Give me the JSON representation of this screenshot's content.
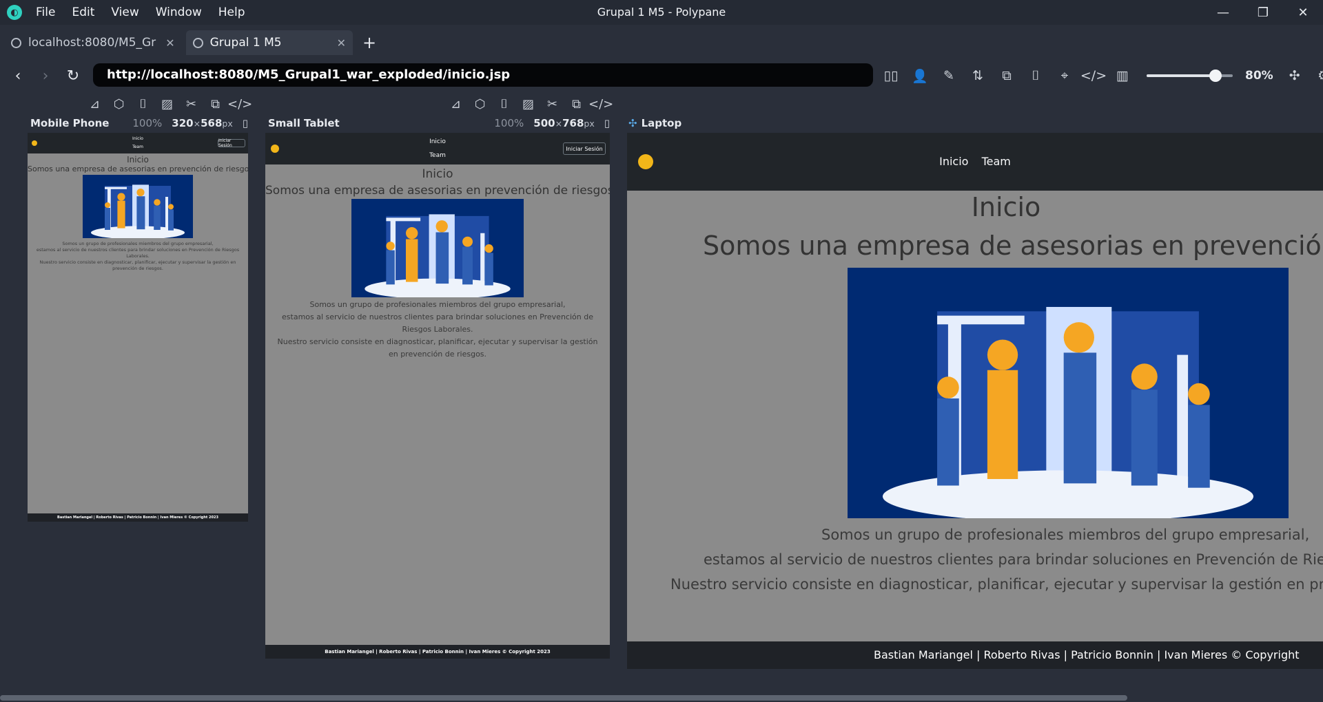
{
  "window": {
    "menu": [
      "File",
      "Edit",
      "View",
      "Window",
      "Help"
    ],
    "title": "Grupal 1 M5 - Polypane"
  },
  "tabs": [
    {
      "label": "localhost:8080/M5_Gr"
    },
    {
      "label": "Grupal 1 M5"
    }
  ],
  "address": {
    "url": "http://localhost:8080/M5_Grupal1_war_exploded/inicio.jsp",
    "zoom": "80%",
    "zoom_level": 0.8
  },
  "panes": {
    "mobile": {
      "name": "Mobile Phone",
      "pct": "100%",
      "w": "320",
      "h": "568",
      "unit": "px"
    },
    "tablet": {
      "name": "Small Tablet",
      "pct": "100%",
      "w": "500",
      "h": "768",
      "unit": "px"
    },
    "laptop": {
      "name": "Laptop"
    }
  },
  "site": {
    "nav_inicio": "Inicio",
    "nav_team": "Team",
    "login": "Iniciar Sesión",
    "title": "Inicio",
    "subtitle": "Somos una empresa de asesorias en prevención de riesgos",
    "laptop_subtitle": "Somos una empresa de asesorias en prevención d",
    "p1": "Somos un grupo de profesionales miembros del grupo empresarial,",
    "p2": "estamos al servicio de nuestros clientes para brindar soluciones en Prevención de Riesgos Laborales.",
    "p3": "Nuestro servicio consiste en diagnosticar, planificar, ejecutar y supervisar la gestión en prevención de riesgos.",
    "laptop_p2": "estamos al servicio de nuestros clientes para brindar soluciones en Prevención de Rie",
    "laptop_p3": "Nuestro servicio consiste en diagnosticar, planificar, ejecutar y supervisar la gestión en pre",
    "footer": "Bastian Mariangel | Roberto Rivas | Patricio Bonnin | Ivan Mieres © Copyright 2023"
  }
}
